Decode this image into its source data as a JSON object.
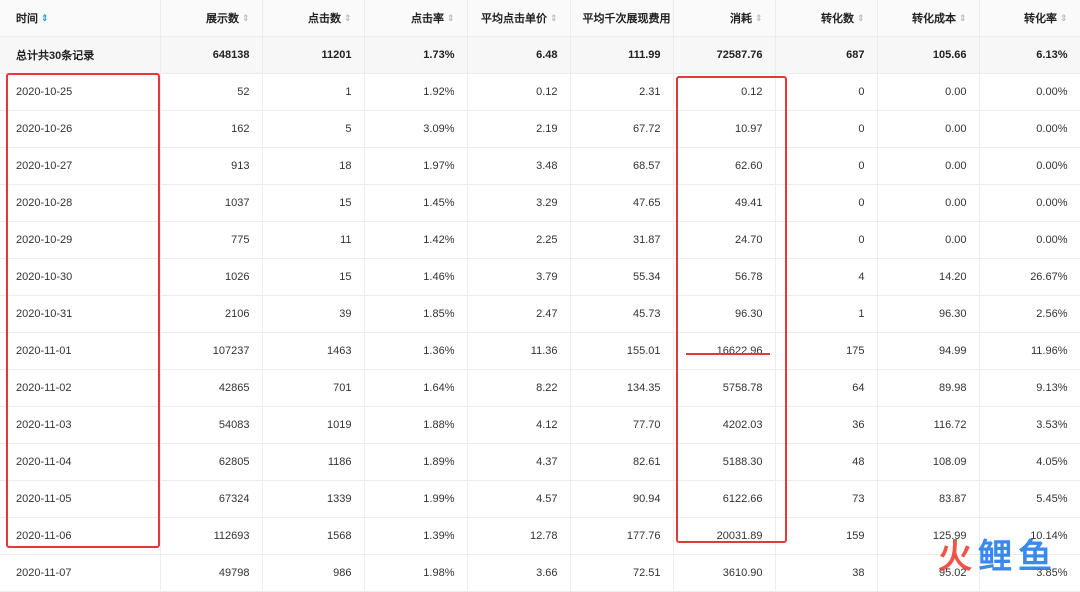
{
  "table": {
    "columns": [
      {
        "label": "时间",
        "sort": "active"
      },
      {
        "label": "展示数",
        "sort": "inactive"
      },
      {
        "label": "点击数",
        "sort": "inactive"
      },
      {
        "label": "点击率",
        "sort": "inactive"
      },
      {
        "label": "平均点击单价",
        "sort": "inactive"
      },
      {
        "label": "平均千次展现费用",
        "sort": "inactive"
      },
      {
        "label": "消耗",
        "sort": "inactive"
      },
      {
        "label": "转化数",
        "sort": "inactive"
      },
      {
        "label": "转化成本",
        "sort": "inactive"
      },
      {
        "label": "转化率",
        "sort": "inactive"
      }
    ],
    "total": [
      "总计共30条记录",
      "648138",
      "11201",
      "1.73%",
      "6.48",
      "111.99",
      "72587.76",
      "687",
      "105.66",
      "6.13%"
    ],
    "rows": [
      [
        "2020-10-25",
        "52",
        "1",
        "1.92%",
        "0.12",
        "2.31",
        "0.12",
        "0",
        "0.00",
        "0.00%"
      ],
      [
        "2020-10-26",
        "162",
        "5",
        "3.09%",
        "2.19",
        "67.72",
        "10.97",
        "0",
        "0.00",
        "0.00%"
      ],
      [
        "2020-10-27",
        "913",
        "18",
        "1.97%",
        "3.48",
        "68.57",
        "62.60",
        "0",
        "0.00",
        "0.00%"
      ],
      [
        "2020-10-28",
        "1037",
        "15",
        "1.45%",
        "3.29",
        "47.65",
        "49.41",
        "0",
        "0.00",
        "0.00%"
      ],
      [
        "2020-10-29",
        "775",
        "11",
        "1.42%",
        "2.25",
        "31.87",
        "24.70",
        "0",
        "0.00",
        "0.00%"
      ],
      [
        "2020-10-30",
        "1026",
        "15",
        "1.46%",
        "3.79",
        "55.34",
        "56.78",
        "4",
        "14.20",
        "26.67%"
      ],
      [
        "2020-10-31",
        "2106",
        "39",
        "1.85%",
        "2.47",
        "45.73",
        "96.30",
        "1",
        "96.30",
        "2.56%"
      ],
      [
        "2020-11-01",
        "107237",
        "1463",
        "1.36%",
        "11.36",
        "155.01",
        "16622.96",
        "175",
        "94.99",
        "11.96%"
      ],
      [
        "2020-11-02",
        "42865",
        "701",
        "1.64%",
        "8.22",
        "134.35",
        "5758.78",
        "64",
        "89.98",
        "9.13%"
      ],
      [
        "2020-11-03",
        "54083",
        "1019",
        "1.88%",
        "4.12",
        "77.70",
        "4202.03",
        "36",
        "116.72",
        "3.53%"
      ],
      [
        "2020-11-04",
        "62805",
        "1186",
        "1.89%",
        "4.37",
        "82.61",
        "5188.30",
        "48",
        "108.09",
        "4.05%"
      ],
      [
        "2020-11-05",
        "67324",
        "1339",
        "1.99%",
        "4.57",
        "90.94",
        "6122.66",
        "73",
        "83.87",
        "5.45%"
      ],
      [
        "2020-11-06",
        "112693",
        "1568",
        "1.39%",
        "12.78",
        "177.76",
        "20031.89",
        "159",
        "125.99",
        "10.14%"
      ],
      [
        "2020-11-07",
        "49798",
        "986",
        "1.98%",
        "3.66",
        "72.51",
        "3610.90",
        "38",
        "95.02",
        "3.85%"
      ]
    ]
  },
  "icons": {
    "sort": "sort-icon",
    "sort_active_color": "#1890ff"
  },
  "colors": {
    "highlight": "#e23a3a"
  },
  "watermark": {
    "chars": [
      "火",
      "鲤",
      "鱼"
    ],
    "colors": [
      "#ee3d2f",
      "#1e7ae8",
      "#1e7ae8"
    ]
  }
}
